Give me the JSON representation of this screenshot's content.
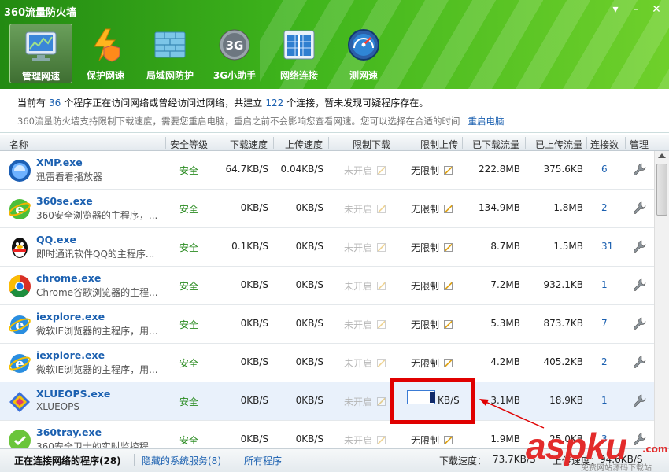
{
  "window": {
    "title": "360流量防火墙",
    "controls": [
      "▾",
      "–",
      "✕"
    ]
  },
  "toolbar": [
    {
      "label": "管理网速",
      "icon": "monitor-chart-icon",
      "active": true
    },
    {
      "label": "保护网速",
      "icon": "lightning-shield-icon",
      "active": false
    },
    {
      "label": "局域网防护",
      "icon": "brick-wall-icon",
      "active": false
    },
    {
      "label": "3G小助手",
      "icon": "3g-badge-icon",
      "active": false
    },
    {
      "label": "网络连接",
      "icon": "network-window-icon",
      "active": false
    },
    {
      "label": "测网速",
      "icon": "speedometer-icon",
      "active": false
    }
  ],
  "info": {
    "line1_a": "当前有",
    "program_count": "36",
    "line1_b": "个程序正在访问网络或曾经访问过网络，共建立",
    "connection_count": "122",
    "line1_c": "个连接，暂未发现可疑程序存在。",
    "line2": "360流量防火墙支持限制下载速度，需要您重启电脑，重启之前不会影响您查看网速。您可以选择在合适的时间",
    "restart_link": "重启电脑"
  },
  "columns": [
    "名称",
    "安全等级",
    "下载速度",
    "上传速度",
    "限制下载",
    "限制上传",
    "已下载流量",
    "已上传流量",
    "连接数",
    "管理"
  ],
  "rows": [
    {
      "name": "XMP.exe",
      "desc": "迅雷看看播放器",
      "icon": "xmp-icon",
      "safety": "安全",
      "down": "64.7KB/S",
      "up": "0.04KB/S",
      "limit_down": "未开启",
      "limit_up": "无限制",
      "downloaded": "222.8MB",
      "uploaded": "375.6KB",
      "conns": "6"
    },
    {
      "name": "360se.exe",
      "desc": "360安全浏览器的主程序，...",
      "icon": "360se-icon",
      "safety": "安全",
      "down": "0KB/S",
      "up": "0KB/S",
      "limit_down": "未开启",
      "limit_up": "无限制",
      "downloaded": "134.9MB",
      "uploaded": "1.8MB",
      "conns": "2"
    },
    {
      "name": "QQ.exe",
      "desc": "即时通讯软件QQ的主程序...",
      "icon": "qq-penguin-icon",
      "safety": "安全",
      "down": "0.1KB/S",
      "up": "0KB/S",
      "limit_down": "未开启",
      "limit_up": "无限制",
      "downloaded": "8.7MB",
      "uploaded": "1.5MB",
      "conns": "31"
    },
    {
      "name": "chrome.exe",
      "desc": "Chrome谷歌浏览器的主程...",
      "icon": "chrome-icon",
      "safety": "安全",
      "down": "0KB/S",
      "up": "0KB/S",
      "limit_down": "未开启",
      "limit_up": "无限制",
      "downloaded": "7.2MB",
      "uploaded": "932.1KB",
      "conns": "1"
    },
    {
      "name": "iexplore.exe",
      "desc": "微软IE浏览器的主程序，用...",
      "icon": "ie-icon",
      "safety": "安全",
      "down": "0KB/S",
      "up": "0KB/S",
      "limit_down": "未开启",
      "limit_up": "无限制",
      "downloaded": "5.3MB",
      "uploaded": "873.7KB",
      "conns": "7"
    },
    {
      "name": "iexplore.exe",
      "desc": "微软IE浏览器的主程序，用...",
      "icon": "ie-icon",
      "safety": "安全",
      "down": "0KB/S",
      "up": "0KB/S",
      "limit_down": "未开启",
      "limit_up": "无限制",
      "downloaded": "4.2MB",
      "uploaded": "405.2KB",
      "conns": "2"
    },
    {
      "name": "XLUEOPS.exe",
      "desc": "XLUEOPS",
      "icon": "xlueops-icon",
      "safety": "安全",
      "down": "0KB/S",
      "up": "0KB/S",
      "limit_down": "未开启",
      "limit_up": "KB/S",
      "downloaded": "3.1MB",
      "uploaded": "18.9KB",
      "conns": "1",
      "editing": true
    },
    {
      "name": "360tray.exe",
      "desc": "360安全卫士的实时监控程...",
      "icon": "360tray-icon",
      "safety": "安全",
      "down": "0KB/S",
      "up": "0KB/S",
      "limit_down": "未开启",
      "limit_up": "无限制",
      "downloaded": "1.9MB",
      "uploaded": "25.0KB",
      "conns": "3"
    }
  ],
  "footer": {
    "tab_active": "正在连接网络的程序(28)",
    "tab_hidden": "隐藏的系统服务(8)",
    "tab_all": "所有程序",
    "down_label": "下载速度：",
    "down_value": "73.7KB/S",
    "up_label": "上传速度：",
    "up_value": "94.6KB/S"
  },
  "watermark": {
    "text": "aspku",
    "suffix": ".com",
    "sub": "免费网站源码下载站"
  },
  "colors": {
    "header_green": "#3fb51c",
    "link_blue": "#1b60b0",
    "safe_green": "#2c8c23",
    "highlight_red": "#e00000"
  }
}
